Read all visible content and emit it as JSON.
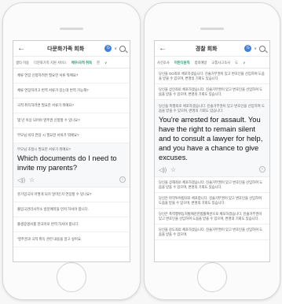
{
  "left": {
    "title": "다문화가족 회화",
    "badge": "G",
    "tabs": [
      "생타 이용",
      "다문화가족 지원 서비스",
      "배우/국적 취득",
      "한"
    ],
    "tab_more": "∨",
    "list_top": [
      "체류 연장 신청하려면 필요한 서류 뭐예요?",
      "체류 연장하려고 번역 서류가 있는데 번역 가능해?",
      "국적 취득하려면 필요한 서류가 뭐예요?",
      "몇 년 이상 되어야 영주권 신청할 수 있나요?",
      "부모님 비자 연장 시 필요한 서류가 뭐예요?"
    ],
    "expanded_small": "부모님 초청시 필요한 서류가 뭐예요?",
    "expanded_big": "Which documents do I need to invite my parents?",
    "list_bottom": [
      "유기입국자 어떻게 되지 얼마든지 연장할 수 있나요?",
      "출입국관리사무소 방문예약을 먼저 하셔야 합니다.",
      "출생증명서를 한국어로 번역 하셔야 합니다.",
      "'영주권과 국적 취득 관련 내용을 알고 싶어요."
    ]
  },
  "right": {
    "title": "경찰 회화",
    "badge": "G",
    "tabs": [
      "사건조사",
      "미란다원칙",
      "범죄예방",
      "교통사고조사",
      "도"
    ],
    "tab_more": "∨",
    "list_top": [
      "당신을 OO죄로 체포하겠습니다. 진술거부권이 있고 변호인을 선임하여 도움을 받을 수 있으며, 변명의 기회도 있습니다.",
      "당신을 상인죄로 체포하겠습니다. 진술거부권이 있고 변호인을 선임하여 도움을 받을 수 있으며, 변명의 기회도 있습니다.",
      "당신을 폭행죄로 체포하겠습니다. 진술거부권이 있고 변호인을 선임하여 도움을 받을 수 있으며, 변명의 기회도 있습니다."
    ],
    "expanded_big": "You're arrested for assault. You have the right to remain silent and to consult a lawyer for help, and you have a chance to give excuses.",
    "list_bottom": [
      "당신을 상해죄로 체포하겠습니다. 진술거부권이 있고 변호인을 선임하여 도움을 받을 수 있으며, 변명의 기회도 있습니다.",
      "당신은 마약투여혐의로 체포합니다. 진술거부권이 있고 변호인을 선임하여 도움을 받을 수 있으며, 변명의 기회도 있습니다.",
      "당신은 폭력행위등처벌에관한법률위반으로 체포하겠습니다. 진술거부권이 있고 변호인을 선임하여 도움을 받을 수 있으며, 변명의 기회도 있습니다.",
      "당신을 강도죄로 체포하겠습니다. 진술거부권이 있고 변호인을 선임하여 도움을 받을 수 있으며."
    ]
  },
  "colors": {
    "accent": "#2e9b76",
    "badge": "#3d7ee0"
  }
}
